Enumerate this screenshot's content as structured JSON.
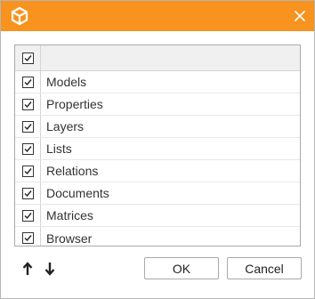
{
  "window": {
    "icon": "cube-logo-icon",
    "close_icon": "close-icon",
    "accent_color": "#f7931e"
  },
  "list": {
    "header_checked": true,
    "items": [
      {
        "label": "Models",
        "checked": true
      },
      {
        "label": "Properties",
        "checked": true
      },
      {
        "label": "Layers",
        "checked": true
      },
      {
        "label": "Lists",
        "checked": true
      },
      {
        "label": "Relations",
        "checked": true
      },
      {
        "label": "Documents",
        "checked": true
      },
      {
        "label": "Matrices",
        "checked": true
      },
      {
        "label": "Browser",
        "checked": true
      }
    ]
  },
  "footer": {
    "move_up_icon": "arrow-up-icon",
    "move_down_icon": "arrow-down-icon",
    "ok_label": "OK",
    "cancel_label": "Cancel"
  }
}
